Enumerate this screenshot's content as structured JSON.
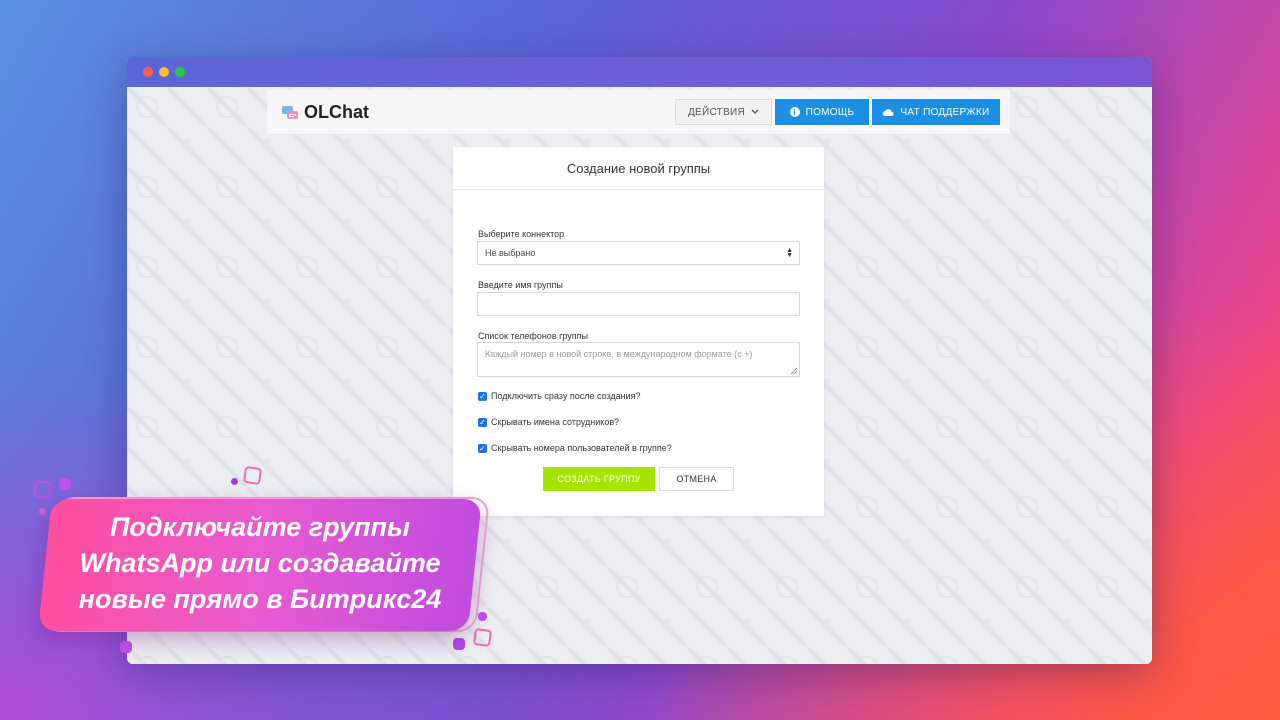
{
  "app": {
    "logo_text": "OLChat",
    "actions_label": "ДЕЙСТВИЯ",
    "help_label": "ПОМОЩЬ",
    "support_label": "ЧАТ ПОДДЕРЖКИ"
  },
  "form": {
    "title": "Создание новой группы",
    "connector_label": "Выберите коннектор",
    "connector_value": "Не выбрано",
    "group_name_label": "Введите имя группы",
    "group_name_value": "",
    "phones_label": "Список телефонов группы",
    "phones_placeholder": "Каждый номер в новой строке, в международном формате (с +)",
    "checkboxes": [
      {
        "label": "Подключить сразу после создания?",
        "checked": true
      },
      {
        "label": "Скрывать имена сотрудников?",
        "checked": true
      },
      {
        "label": "Скрывать номера пользователей в группе?",
        "checked": true
      }
    ],
    "create_label": "СОЗДАТЬ ГРУППУ",
    "cancel_label": "ОТМЕНА"
  },
  "promo": {
    "line1": "Подключайте группы",
    "line2": "WhatsApp или создавайте",
    "line3": "новые прямо в Битрикс24"
  },
  "colors": {
    "primary": "#1a8fe3",
    "create_button": "#a6e400",
    "checkbox": "#1a73e8",
    "banner": "#e85ad0"
  }
}
